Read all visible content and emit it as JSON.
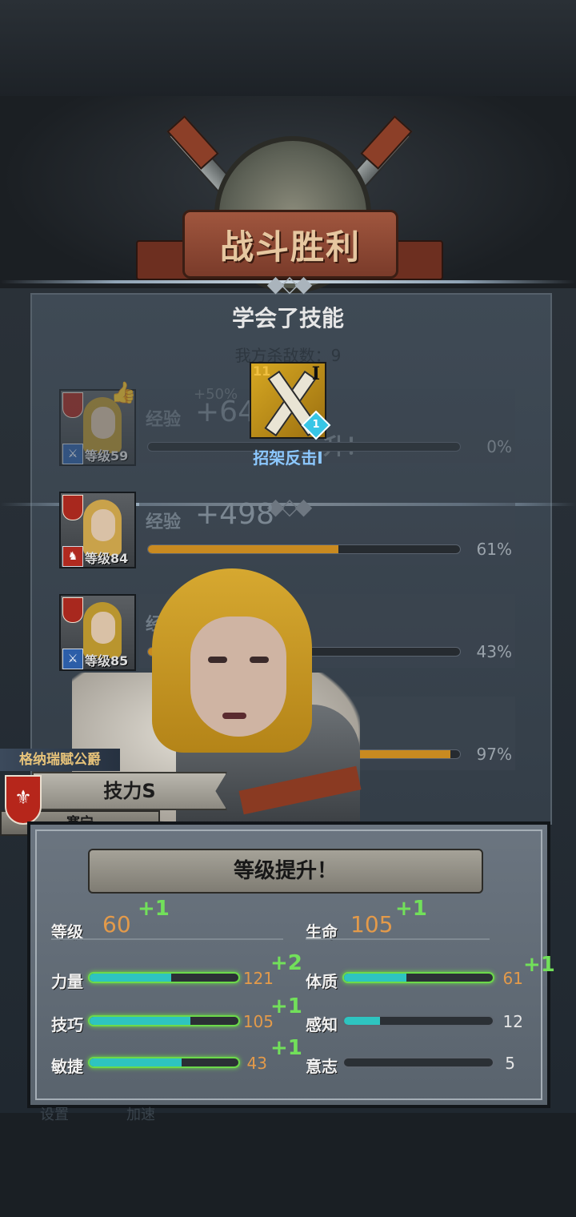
{
  "banner": {
    "title": "战斗胜利"
  },
  "skill_learned": {
    "heading": "学会了技能",
    "kills_text": "我方杀敌数：9",
    "skill": {
      "name": "招架反击I",
      "rank": "I",
      "tier": "1",
      "badge": "11"
    }
  },
  "party_rows": [
    {
      "exp_label": "经验",
      "exp_gain": "+64",
      "bonus": "+50%",
      "level_label": "等级59",
      "progress_pct": "0%",
      "progress": 0,
      "overlay_text": "升！",
      "class_icon": "sword-icon"
    },
    {
      "exp_label": "经验",
      "exp_gain": "+498",
      "level_label": "等级84",
      "progress_pct": "61%",
      "progress": 61,
      "class_icon": "horse-icon"
    },
    {
      "exp_label": "经",
      "exp_gain": "",
      "level_label": "等级85",
      "progress_pct": "43%",
      "progress": 43,
      "class_icon": "sword-icon"
    },
    {
      "exp_label": "",
      "exp_gain": "",
      "level_label": "",
      "progress_pct": "97%",
      "progress": 97,
      "class_icon": ""
    }
  ],
  "character": {
    "title": "格纳瑞赋公爵",
    "skill_rank": "技力S",
    "name": "塞宁"
  },
  "level_up": {
    "heading": "等级提升！",
    "level": {
      "label": "等级",
      "value": "60",
      "plus": "+1"
    },
    "hp": {
      "label": "生命",
      "value": "105",
      "plus": "+1"
    },
    "stats": [
      {
        "label": "力量",
        "value": "121",
        "plus": "+2",
        "fill": 0.55
      },
      {
        "label": "体质",
        "value": "61",
        "plus": "+1",
        "fill": 0.42
      },
      {
        "label": "技巧",
        "value": "105",
        "plus": "+1",
        "fill": 0.68
      },
      {
        "label": "感知",
        "value": "12",
        "plus": "",
        "fill": 0.24
      },
      {
        "label": "敏捷",
        "value": "43",
        "plus": "+1",
        "fill": 0.62
      },
      {
        "label": "意志",
        "value": "5",
        "plus": "",
        "fill": 0.0
      }
    ]
  },
  "bottom": {
    "tab1": "设置",
    "tab2": "加速"
  }
}
